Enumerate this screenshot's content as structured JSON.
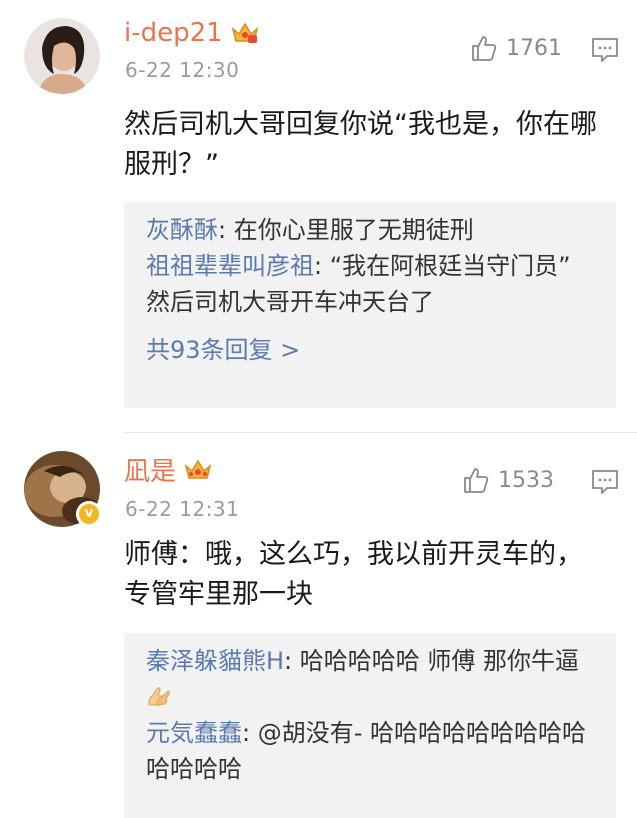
{
  "comments": [
    {
      "username": "i-dep21",
      "time": "6-22 12:30",
      "likes": "1761",
      "body": "然后司机大哥回复你说“我也是，你在哪服刑？”",
      "replies": [
        {
          "name": "灰酥酥",
          "sep": ": ",
          "text": "在你心里服了无期徒刑"
        },
        {
          "name": "祖祖辈辈叫彦祖",
          "sep": ": ",
          "text": "“我在阿根廷当守门员” 然后司机大哥开车冲天台了"
        }
      ],
      "more_replies": "共93条回复 >"
    },
    {
      "username": "凪是",
      "time": "6-22 12:31",
      "likes": "1533",
      "badge": "v",
      "body": "师傅：哦，这么巧，我以前开灵车的，专管牢里那一块",
      "replies": [
        {
          "name": "秦泽躲貓熊H",
          "sep": ": ",
          "text": "哈哈哈哈哈 师傅 那你牛逼"
        },
        {
          "name": "元気蠢蠢",
          "sep": ": ",
          "text": "@胡没有- 哈哈哈哈哈哈哈哈哈哈哈哈哈"
        }
      ]
    }
  ],
  "colors": {
    "username": "#eb7350",
    "reply_name": "#5b7bb0",
    "time": "#9b9b9b",
    "reply_bg": "#f2f2f2",
    "badge": "#f6b623"
  },
  "icons": [
    "crown-icon",
    "thumbs-up-icon",
    "reply-comment-icon",
    "verified-badge-icon",
    "pray-hands-emoji"
  ]
}
